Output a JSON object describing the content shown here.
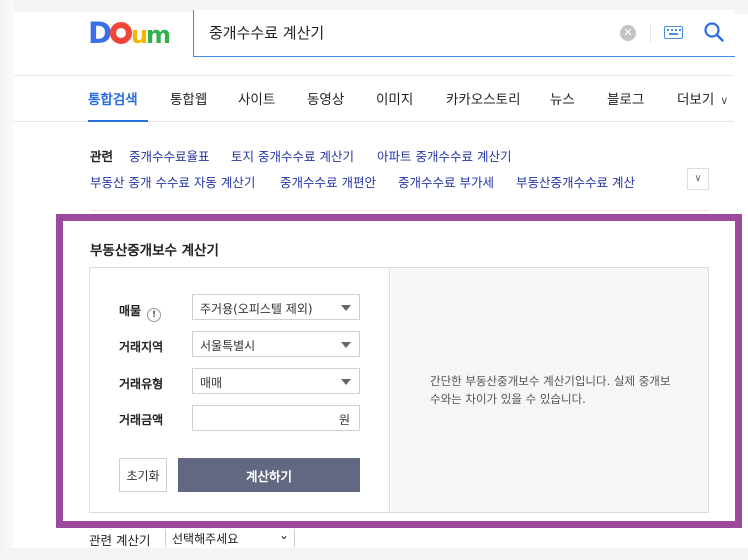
{
  "search": {
    "query": "중개수수료 계산기"
  },
  "tabs": [
    {
      "label": "통합검색",
      "active": true
    },
    {
      "label": "통합웹"
    },
    {
      "label": "사이트"
    },
    {
      "label": "동영상"
    },
    {
      "label": "이미지"
    },
    {
      "label": "카카오스토리"
    },
    {
      "label": "뉴스"
    },
    {
      "label": "블로그"
    },
    {
      "label": "더보기"
    }
  ],
  "related": {
    "title": "관련",
    "links": [
      "중개수수료율표",
      "토지 중개수수료 계산기",
      "아파트 중개수수료 계산기",
      "부동산 중개 수수료 자동 계산기",
      "중개수수료 개편안",
      "중개수수료 부가세",
      "부동산중개수수료 계산"
    ]
  },
  "calculator": {
    "title": "부동산중개보수 계산기",
    "fields": {
      "property": {
        "label": "매물",
        "value": "주거용(오피스텔 제외)"
      },
      "region": {
        "label": "거래지역",
        "value": "서울특별시"
      },
      "type": {
        "label": "거래유형",
        "value": "매매"
      },
      "amount": {
        "label": "거래금액",
        "value": "",
        "unit": "원"
      }
    },
    "reset_label": "초기화",
    "submit_label": "계산하기",
    "info_text": "간단한 부동산중개보수 계산기입니다. 실제 중개보수와는 차이가 있을 수 있습니다."
  },
  "footer": {
    "label": "관련 계산기",
    "select_value": "선택해주세요"
  },
  "colors": {
    "brand_blue": "#2a6ee2",
    "highlight_frame": "#9b4a9e",
    "button_dark": "#636882",
    "link": "#2536a8"
  }
}
